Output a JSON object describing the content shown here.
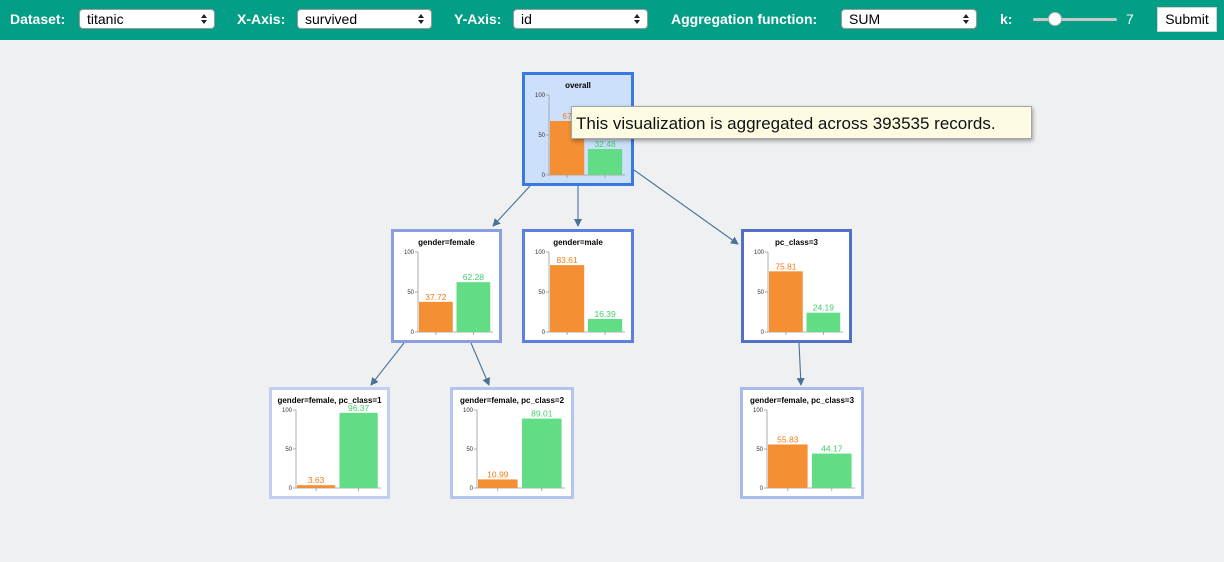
{
  "toolbar": {
    "dataset_label": "Dataset:",
    "dataset_value": "titanic",
    "xaxis_label": "X-Axis:",
    "xaxis_value": "survived",
    "yaxis_label": "Y-Axis:",
    "yaxis_value": "id",
    "agg_label": "Aggregation function:",
    "agg_value": "SUM",
    "k_label": "k:",
    "k_value": "7",
    "submit_label": "Submit",
    "bg_color": "#029e86"
  },
  "tooltip": {
    "text": "This visualization is aggregated across 393535 records."
  },
  "colors": {
    "bar_first": "#f48f34",
    "bar_second": "#63dd85",
    "label_first": "#f07b1c",
    "label_second": "#3fcf6a",
    "edge": "#4a7296"
  },
  "chart_data": [
    {
      "id": "overall",
      "type": "bar",
      "title": "overall",
      "values": [
        67.52,
        32.48
      ],
      "value_labels": [
        "67",
        "32.48"
      ],
      "ylim": [
        0,
        100
      ],
      "yticks": [
        "0",
        "50",
        "100"
      ]
    },
    {
      "id": "female",
      "type": "bar",
      "title": "gender=female",
      "values": [
        37.72,
        62.28
      ],
      "value_labels": [
        "37.72",
        "62.28"
      ],
      "ylim": [
        0,
        100
      ],
      "yticks": [
        "0",
        "50",
        "100"
      ]
    },
    {
      "id": "male",
      "type": "bar",
      "title": "gender=male",
      "values": [
        83.61,
        16.39
      ],
      "value_labels": [
        "83.61",
        "16.39"
      ],
      "ylim": [
        0,
        100
      ],
      "yticks": [
        "0",
        "50",
        "100"
      ]
    },
    {
      "id": "pc3",
      "type": "bar",
      "title": "pc_class=3",
      "values": [
        75.81,
        24.19
      ],
      "value_labels": [
        "75.81",
        "24.19"
      ],
      "ylim": [
        0,
        100
      ],
      "yticks": [
        "0",
        "50",
        "100"
      ]
    },
    {
      "id": "f_pc1",
      "type": "bar",
      "title": "gender=female, pc_class=1",
      "values": [
        3.63,
        96.37
      ],
      "value_labels": [
        "3.63",
        "96.37"
      ],
      "ylim": [
        0,
        100
      ],
      "yticks": [
        "0",
        "50",
        "100"
      ]
    },
    {
      "id": "f_pc2",
      "type": "bar",
      "title": "gender=female, pc_class=2",
      "values": [
        10.99,
        89.01
      ],
      "value_labels": [
        "10.99",
        "89.01"
      ],
      "ylim": [
        0,
        100
      ],
      "yticks": [
        "0",
        "50",
        "100"
      ]
    },
    {
      "id": "f_pc3",
      "type": "bar",
      "title": "gender=female, pc_class=3",
      "values": [
        55.83,
        44.17
      ],
      "value_labels": [
        "55.83",
        "44.17"
      ],
      "ylim": [
        0,
        100
      ],
      "yticks": [
        "0",
        "50",
        "100"
      ]
    }
  ],
  "tree_edges": [
    {
      "from": "overall",
      "to": "female"
    },
    {
      "from": "overall",
      "to": "male"
    },
    {
      "from": "overall",
      "to": "pc3"
    },
    {
      "from": "female",
      "to": "f_pc1"
    },
    {
      "from": "female",
      "to": "f_pc2"
    },
    {
      "from": "pc3",
      "to": "f_pc3"
    }
  ]
}
